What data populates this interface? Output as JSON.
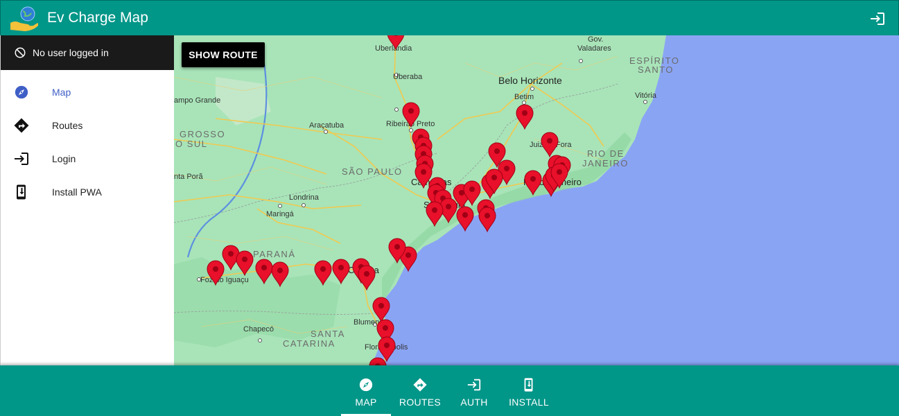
{
  "app": {
    "title": "Ev Charge Map"
  },
  "sidebar": {
    "user_status": "No user logged in",
    "items": [
      {
        "label": "Map",
        "icon": "compass-icon",
        "active": true
      },
      {
        "label": "Routes",
        "icon": "directions-icon",
        "active": false
      },
      {
        "label": "Login",
        "icon": "login-icon",
        "active": false
      },
      {
        "label": "Install PWA",
        "icon": "install-phone-icon",
        "active": false
      }
    ]
  },
  "map": {
    "show_route_label": "SHOW ROUTE",
    "labels": {
      "uberlandia": "Uberlândia",
      "uberaba": "Uberaba",
      "gov_valadares_1": "Gov.",
      "gov_valadares_2": "Valadares",
      "espirito_1": "ESPÍRITO",
      "espirito_2": "SANTO",
      "belo_horizonte": "Belo Horizonte",
      "betim": "Betim",
      "vitoria": "Vitória",
      "campo_grande": "ampo Grande",
      "grosso_1": "GROSSO",
      "grosso_2": "O SUL",
      "ribeirao": "Ribeirão Preto",
      "aracatuba": "Araçatuba",
      "juiz_fora": "Juiz de Fora",
      "rio_state_1": "RIO DE",
      "rio_state_2": "JANEIRO",
      "sao_paulo_state": "SÃO PAULO",
      "rio_city": "Rio de Janeiro",
      "campinas": "Campinas",
      "sao_paulo_city": "São Paulo",
      "ponta_pora": "nta Porã",
      "londrina": "Londrina",
      "maringa": "Maringá",
      "parana": "PARANÁ",
      "foz": "Foz do Iguaçu",
      "curitiba": "Curitiba",
      "chapeco": "Chapecó",
      "blumenau": "Blumenau",
      "santa_1": "SANTA",
      "santa_2": "CATARINA",
      "florianopolis": "Florianópolis"
    }
  },
  "bottom_nav": [
    {
      "label": "MAP",
      "icon": "compass-icon",
      "active": true
    },
    {
      "label": "ROUTES",
      "icon": "directions-icon",
      "active": false
    },
    {
      "label": "AUTH",
      "icon": "login-icon",
      "active": false
    },
    {
      "label": "INSTALL",
      "icon": "install-phone-icon",
      "active": false
    }
  ],
  "colors": {
    "primary": "#009688",
    "active_nav": "#3f5fc6",
    "marker": "#e8102a",
    "ocean": "#8aa4f4",
    "land": "#a8e4b8"
  }
}
